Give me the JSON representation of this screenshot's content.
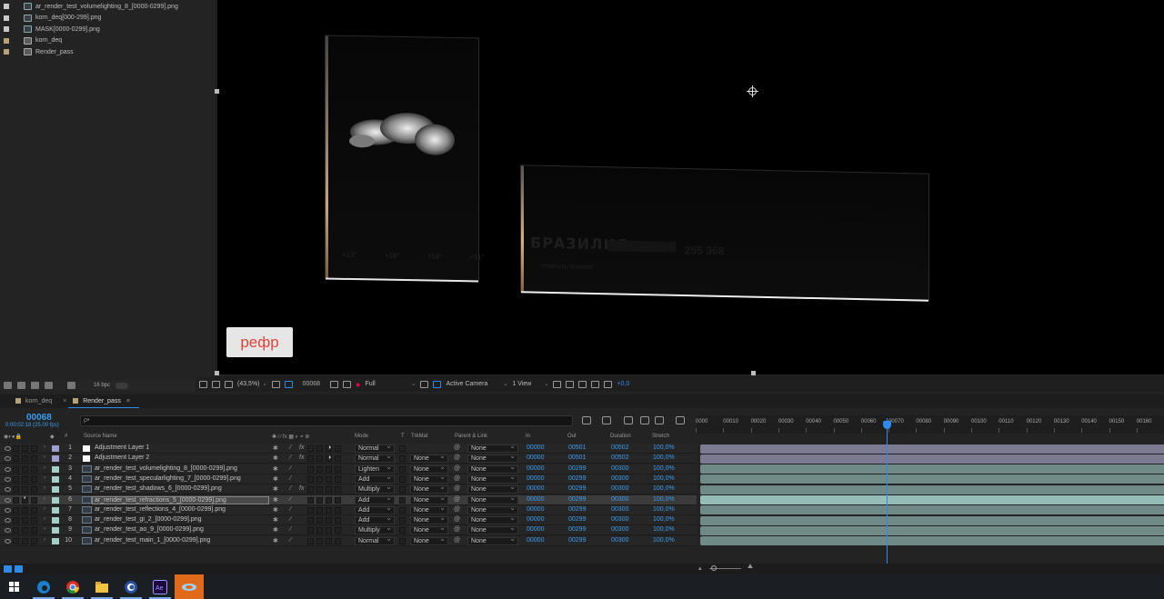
{
  "project": {
    "items": [
      {
        "name": "ar_render_test_volumelighting_8_[0000-0299].png",
        "label_color": "#c8c8c8",
        "kind": "footage"
      },
      {
        "name": "korn_deq[000-299].png",
        "label_color": "#c8c8c8",
        "kind": "footage"
      },
      {
        "name": "MASK[0000-0299].png",
        "label_color": "#c8c8c8",
        "kind": "footage"
      },
      {
        "name": "korn_deq",
        "label_color": "#b5a27a",
        "kind": "comp"
      },
      {
        "name": "Render_pass",
        "label_color": "#b5a27a",
        "kind": "comp"
      }
    ],
    "bpc": "16 bpc"
  },
  "viewer": {
    "overlay_text": "рефр",
    "card1_ghost_texts": [
      "+13°",
      "+16°",
      "+18°",
      "+11°"
    ],
    "card2_ghost_text": "БРАЗИЛИЯ",
    "card2_ghost_number": "255 368",
    "card2_ghost_small": "ОТКРЫТЬ СПИСОК"
  },
  "viewer_bar": {
    "zoom": "(43,5%)",
    "frame": "00068",
    "resolution": "Full",
    "camera": "Active Camera",
    "views": "1 View",
    "exposure": "+0,0"
  },
  "tabs": [
    {
      "label": "korn_deq",
      "color": "#b5a27a",
      "active": false
    },
    {
      "label": "Render_pass",
      "color": "#b5a27a",
      "active": true
    }
  ],
  "timeline": {
    "timecode": "00068",
    "timecode_sub": "0:00:02:18 (25.00 fps)",
    "search_placeholder": "ρ•",
    "headers": {
      "number": "#",
      "source": "Source Name",
      "mode": "Mode",
      "t": "T",
      "trkmat": "TrkMat",
      "parent": "Parent & Link",
      "in": "In",
      "out": "Out",
      "duration": "Duration",
      "stretch": "Stretch"
    },
    "ruler": [
      "0000",
      "00010",
      "00020",
      "00030",
      "00040",
      "00050",
      "00060",
      "00070",
      "00080",
      "00090",
      "00100",
      "00110",
      "00120",
      "00130",
      "00140",
      "00150",
      "00160"
    ],
    "layers": [
      {
        "num": "1",
        "name": "Adjustment Layer 1",
        "type": "adjust",
        "label": "#a0a0d0",
        "fx": true,
        "mode": "Normal",
        "trkmat": "",
        "parent": "None",
        "in": "00000",
        "out": "00501",
        "duration": "00502",
        "stretch": "100,0%",
        "bar": "#7c7a93"
      },
      {
        "num": "2",
        "name": "Adjustment Layer 2",
        "type": "adjust",
        "label": "#a0a0d0",
        "fx": true,
        "mode": "Normal",
        "trkmat": "None",
        "parent": "None",
        "in": "00000",
        "out": "00501",
        "duration": "00502",
        "stretch": "100,0%",
        "bar": "#7c7a93"
      },
      {
        "num": "3",
        "name": "ar_render_test_volumelighting_8_[0000-0299].png",
        "type": "footage",
        "label": "#a4d0c8",
        "fx": false,
        "mode": "Lighten",
        "trkmat": "None",
        "parent": "None",
        "in": "00000",
        "out": "00299",
        "duration": "00300",
        "stretch": "100,0%",
        "bar": "#6f8a87"
      },
      {
        "num": "4",
        "name": "ar_render_test_specularlighting_7_[0000-0299].png",
        "type": "footage",
        "label": "#a4d0c8",
        "fx": false,
        "mode": "Add",
        "trkmat": "None",
        "parent": "None",
        "in": "00000",
        "out": "00299",
        "duration": "00300",
        "stretch": "100,0%",
        "bar": "#6f8a87"
      },
      {
        "num": "5",
        "name": "ar_render_test_shadows_6_[0000-0299].png",
        "type": "footage",
        "label": "#a4d0c8",
        "fx": true,
        "mode": "Multiply",
        "trkmat": "None",
        "parent": "None",
        "in": "00000",
        "out": "00299",
        "duration": "00300",
        "stretch": "100,0%",
        "bar": "#6f8a87"
      },
      {
        "num": "6",
        "name": "ar_render_test_refractions_5_[0000-0299].png",
        "type": "footage",
        "label": "#a4d0c8",
        "fx": false,
        "mode": "Add",
        "trkmat": "None",
        "parent": "None",
        "in": "00000",
        "out": "00299",
        "duration": "00300",
        "stretch": "100,0%",
        "bar": "#95bdb7",
        "selected": true
      },
      {
        "num": "7",
        "name": "ar_render_test_reflections_4_[0000-0299].png",
        "type": "footage",
        "label": "#a4d0c8",
        "fx": false,
        "mode": "Add",
        "trkmat": "None",
        "parent": "None",
        "in": "00000",
        "out": "00299",
        "duration": "00300",
        "stretch": "100,0%",
        "bar": "#6f8a87"
      },
      {
        "num": "8",
        "name": "ar_render_test_gi_2_[0000-0299].png",
        "type": "footage",
        "label": "#a4d0c8",
        "fx": false,
        "mode": "Add",
        "trkmat": "None",
        "parent": "None",
        "in": "00000",
        "out": "00299",
        "duration": "00300",
        "stretch": "100,0%",
        "bar": "#6f8a87"
      },
      {
        "num": "9",
        "name": "ar_render_test_ao_9_[0000-0299].png",
        "type": "footage",
        "label": "#a4d0c8",
        "fx": false,
        "mode": "Multiply",
        "trkmat": "None",
        "parent": "None",
        "in": "00000",
        "out": "00299",
        "duration": "00300",
        "stretch": "100,0%",
        "bar": "#6f8a87"
      },
      {
        "num": "10",
        "name": "ar_render_test_main_1_[0000-0299].png",
        "type": "footage",
        "label": "#a4d0c8",
        "fx": false,
        "mode": "Normal",
        "trkmat": "None",
        "parent": "None",
        "in": "00000",
        "out": "00299",
        "duration": "00300",
        "stretch": "100,0%",
        "bar": "#6f8a87"
      }
    ]
  },
  "taskbar": [
    "windows-start-icon",
    "edge-icon",
    "chrome-icon",
    "file-explorer-icon",
    "cinema4d-icon",
    "after-effects-icon",
    "app-active-icon"
  ]
}
